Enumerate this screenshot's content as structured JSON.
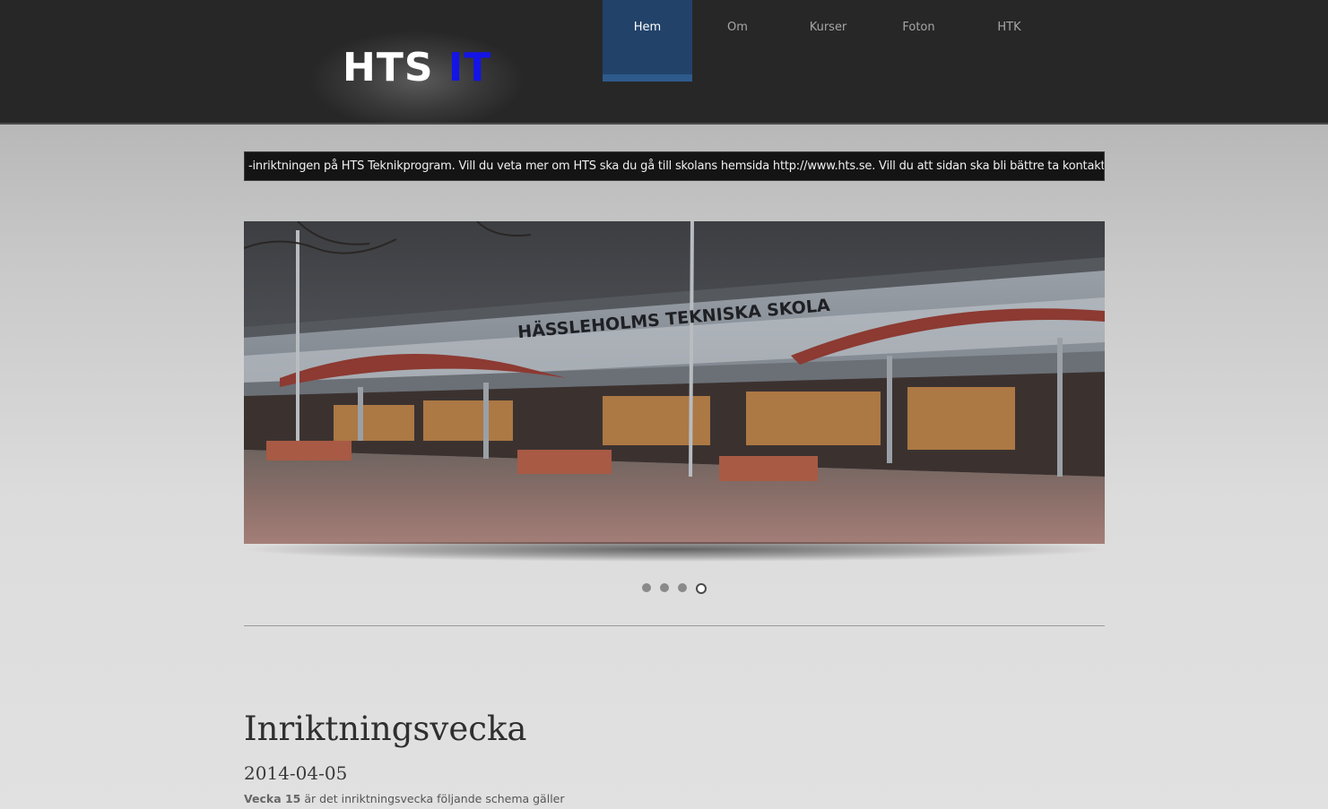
{
  "header": {
    "logo_main": "HTS",
    "logo_accent": "IT",
    "accent_color": "#1414e6",
    "nav": [
      {
        "label": "Hem",
        "active": true
      },
      {
        "label": "Om",
        "active": false
      },
      {
        "label": "Kurser",
        "active": false
      },
      {
        "label": "Foton",
        "active": false
      },
      {
        "label": "HTK",
        "active": false
      }
    ]
  },
  "ticker": {
    "text": "-inriktningen på HTS Teknikprogram. Vill du veta mer om HTS ska du gå till skolans hemsida http://www.hts.se. Vill du att sidan ska bli bättre ta kontakt med L"
  },
  "slider": {
    "image_sign": "HÄSSLEHOLMS TEKNISKA SKOLA",
    "dot_count": 4,
    "active_dot": 4
  },
  "post": {
    "title": "Inriktningsvecka",
    "date": "2014-04-05",
    "body_bold": "Vecka 15",
    "body_rest": " är det inriktningsvecka följande schema gäller"
  }
}
